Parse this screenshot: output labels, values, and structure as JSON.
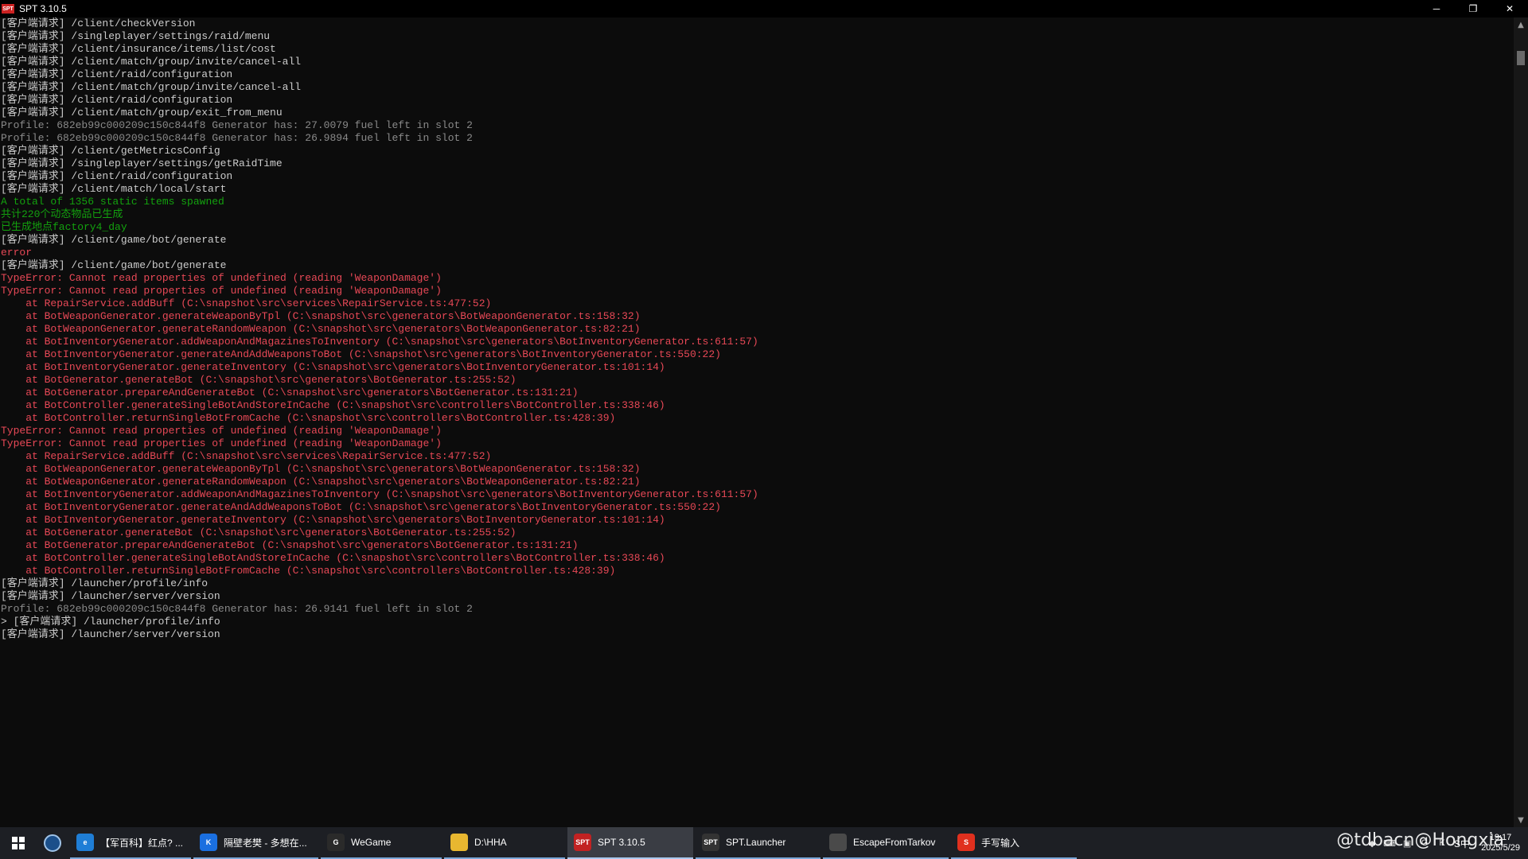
{
  "window": {
    "app_icon": "SPT",
    "title": "SPT 3.10.5",
    "minimize": "─",
    "maximize": "❐",
    "close": "✕"
  },
  "console_lines": [
    {
      "text": "[客户端请求] /client/checkVersion",
      "color": "white"
    },
    {
      "text": "[客户端请求] /singleplayer/settings/raid/menu",
      "color": "white"
    },
    {
      "text": "[客户端请求] /client/insurance/items/list/cost",
      "color": "white"
    },
    {
      "text": "[客户端请求] /client/match/group/invite/cancel-all",
      "color": "white"
    },
    {
      "text": "[客户端请求] /client/raid/configuration",
      "color": "white"
    },
    {
      "text": "[客户端请求] /client/match/group/invite/cancel-all",
      "color": "white"
    },
    {
      "text": "[客户端请求] /client/raid/configuration",
      "color": "white"
    },
    {
      "text": "[客户端请求] /client/match/group/exit_from_menu",
      "color": "white"
    },
    {
      "text": "Profile: 682eb99c000209c150c844f8 Generator has: 27.0079 fuel left in slot 2",
      "color": "gray"
    },
    {
      "text": "Profile: 682eb99c000209c150c844f8 Generator has: 26.9894 fuel left in slot 2",
      "color": "gray"
    },
    {
      "text": "[客户端请求] /client/getMetricsConfig",
      "color": "white"
    },
    {
      "text": "[客户端请求] /singleplayer/settings/getRaidTime",
      "color": "white"
    },
    {
      "text": "[客户端请求] /client/raid/configuration",
      "color": "white"
    },
    {
      "text": "[客户端请求] /client/match/local/start",
      "color": "white"
    },
    {
      "text": "A total of 1356 static items spawned",
      "color": "green"
    },
    {
      "text": "共计220个动态物品已生成",
      "color": "green"
    },
    {
      "text": "已生成地点factory4_day",
      "color": "green"
    },
    {
      "text": "[客户端请求] /client/game/bot/generate",
      "color": "white"
    },
    {
      "text": "error",
      "color": "red"
    },
    {
      "text": "[客户端请求] /client/game/bot/generate",
      "color": "white"
    },
    {
      "text": "TypeError: Cannot read properties of undefined (reading 'WeaponDamage')",
      "color": "red"
    },
    {
      "text": "TypeError: Cannot read properties of undefined (reading 'WeaponDamage')",
      "color": "red"
    },
    {
      "text": "    at RepairService.addBuff (C:\\snapshot\\src\\services\\RepairService.ts:477:52)",
      "color": "red"
    },
    {
      "text": "    at BotWeaponGenerator.generateWeaponByTpl (C:\\snapshot\\src\\generators\\BotWeaponGenerator.ts:158:32)",
      "color": "red"
    },
    {
      "text": "    at BotWeaponGenerator.generateRandomWeapon (C:\\snapshot\\src\\generators\\BotWeaponGenerator.ts:82:21)",
      "color": "red"
    },
    {
      "text": "    at BotInventoryGenerator.addWeaponAndMagazinesToInventory (C:\\snapshot\\src\\generators\\BotInventoryGenerator.ts:611:57)",
      "color": "red"
    },
    {
      "text": "    at BotInventoryGenerator.generateAndAddWeaponsToBot (C:\\snapshot\\src\\generators\\BotInventoryGenerator.ts:550:22)",
      "color": "red"
    },
    {
      "text": "    at BotInventoryGenerator.generateInventory (C:\\snapshot\\src\\generators\\BotInventoryGenerator.ts:101:14)",
      "color": "red"
    },
    {
      "text": "    at BotGenerator.generateBot (C:\\snapshot\\src\\generators\\BotGenerator.ts:255:52)",
      "color": "red"
    },
    {
      "text": "    at BotGenerator.prepareAndGenerateBot (C:\\snapshot\\src\\generators\\BotGenerator.ts:131:21)",
      "color": "red"
    },
    {
      "text": "    at BotController.generateSingleBotAndStoreInCache (C:\\snapshot\\src\\controllers\\BotController.ts:338:46)",
      "color": "red"
    },
    {
      "text": "    at BotController.returnSingleBotFromCache (C:\\snapshot\\src\\controllers\\BotController.ts:428:39)",
      "color": "red"
    },
    {
      "text": "TypeError: Cannot read properties of undefined (reading 'WeaponDamage')",
      "color": "red"
    },
    {
      "text": "TypeError: Cannot read properties of undefined (reading 'WeaponDamage')",
      "color": "red"
    },
    {
      "text": "    at RepairService.addBuff (C:\\snapshot\\src\\services\\RepairService.ts:477:52)",
      "color": "red"
    },
    {
      "text": "    at BotWeaponGenerator.generateWeaponByTpl (C:\\snapshot\\src\\generators\\BotWeaponGenerator.ts:158:32)",
      "color": "red"
    },
    {
      "text": "    at BotWeaponGenerator.generateRandomWeapon (C:\\snapshot\\src\\generators\\BotWeaponGenerator.ts:82:21)",
      "color": "red"
    },
    {
      "text": "    at BotInventoryGenerator.addWeaponAndMagazinesToInventory (C:\\snapshot\\src\\generators\\BotInventoryGenerator.ts:611:57)",
      "color": "red"
    },
    {
      "text": "    at BotInventoryGenerator.generateAndAddWeaponsToBot (C:\\snapshot\\src\\generators\\BotInventoryGenerator.ts:550:22)",
      "color": "red"
    },
    {
      "text": "    at BotInventoryGenerator.generateInventory (C:\\snapshot\\src\\generators\\BotInventoryGenerator.ts:101:14)",
      "color": "red"
    },
    {
      "text": "    at BotGenerator.generateBot (C:\\snapshot\\src\\generators\\BotGenerator.ts:255:52)",
      "color": "red"
    },
    {
      "text": "    at BotGenerator.prepareAndGenerateBot (C:\\snapshot\\src\\generators\\BotGenerator.ts:131:21)",
      "color": "red"
    },
    {
      "text": "    at BotController.generateSingleBotAndStoreInCache (C:\\snapshot\\src\\controllers\\BotController.ts:338:46)",
      "color": "red"
    },
    {
      "text": "    at BotController.returnSingleBotFromCache (C:\\snapshot\\src\\controllers\\BotController.ts:428:39)",
      "color": "red"
    },
    {
      "text": "[客户端请求] /launcher/profile/info",
      "color": "white"
    },
    {
      "text": "[客户端请求] /launcher/server/version",
      "color": "white"
    },
    {
      "text": "Profile: 682eb99c000209c150c844f8 Generator has: 26.9141 fuel left in slot 2",
      "color": "gray"
    },
    {
      "text": "> [客户端请求] /launcher/profile/info",
      "color": "white"
    },
    {
      "text": "[客户端请求] /launcher/server/version",
      "color": "white"
    }
  ],
  "colors": {
    "white": "#cccccc",
    "gray": "#8a8a8a",
    "green": "#13a10e",
    "red": "#e74856"
  },
  "taskbar": {
    "start_icon": "windows-logo-icon",
    "pinned": [
      {
        "name": "steam-icon"
      }
    ],
    "tasks": [
      {
        "label": "【军百科】红点? ...",
        "icon": "edge-icon",
        "icon_bg": "#1f7ed6",
        "icon_text": "e",
        "active": false
      },
      {
        "label": "隔壁老樊 - 多想在...",
        "icon": "kugou-icon",
        "icon_bg": "#1a6fe0",
        "icon_text": "K",
        "active": false
      },
      {
        "label": "WeGame",
        "icon": "wegame-icon",
        "icon_bg": "#2a2a2a",
        "icon_text": "G",
        "active": false
      },
      {
        "label": "D:\\HHA",
        "icon": "folder-icon",
        "icon_bg": "#e8b730",
        "icon_text": "",
        "active": false
      },
      {
        "label": "SPT 3.10.5",
        "icon": "spt-icon",
        "icon_bg": "#c22222",
        "icon_text": "SPT",
        "active": true
      },
      {
        "label": "SPT.Launcher",
        "icon": "spt-launcher-icon",
        "icon_bg": "#333333",
        "icon_text": "SPT",
        "active": false
      },
      {
        "label": "EscapeFromTarkov",
        "icon": "tarkov-icon",
        "icon_bg": "#4a4a4a",
        "icon_text": "",
        "active": false
      },
      {
        "label": "手写输入",
        "icon": "sogou-icon",
        "icon_bg": "#e0301e",
        "icon_text": "S",
        "active": false
      }
    ],
    "tray": {
      "icons": [
        "nvidia-icon",
        "keyboard-icon",
        "network-icon",
        "google-icon",
        "kugou-tray-icon"
      ],
      "ime_text": "S中",
      "watermark": "@tdbacn@Hongxia",
      "time": "19:17",
      "date": "2025/5/29"
    }
  }
}
